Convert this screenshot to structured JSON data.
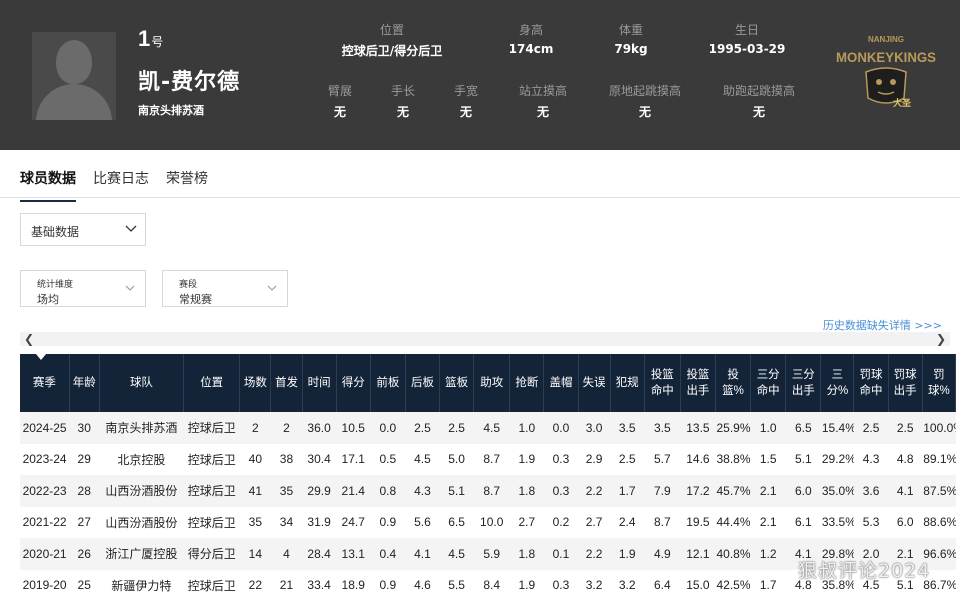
{
  "player": {
    "number": "1",
    "number_suffix": "号",
    "name": "凯-费尔德",
    "team": "南京头排苏酒"
  },
  "info_top": [
    {
      "label": "位置",
      "value": "控球后卫/得分后卫"
    },
    {
      "label": "身高",
      "value": "174cm"
    },
    {
      "label": "体重",
      "value": "79kg"
    },
    {
      "label": "生日",
      "value": "1995-03-29"
    }
  ],
  "info_bottom": [
    {
      "label": "臂展",
      "value": "无"
    },
    {
      "label": "手长",
      "value": "无"
    },
    {
      "label": "手宽",
      "value": "无"
    },
    {
      "label": "站立摸高",
      "value": "无"
    },
    {
      "label": "原地起跳摸高",
      "value": "无"
    },
    {
      "label": "助跑起跳摸高",
      "value": "无"
    }
  ],
  "logo": {
    "top_text": "NANJING",
    "main_text": "MONKEYKINGS",
    "badge": "大圣",
    "color": "#b89a5a"
  },
  "tabs": [
    "球员数据",
    "比赛日志",
    "荣誉榜"
  ],
  "filters": {
    "data_type": "基础数据",
    "dimension_label": "统计维度",
    "dimension_value": "场均",
    "phase_label": "赛段",
    "phase_value": "常规赛"
  },
  "history_link": "历史数据缺失详情 >>>",
  "table": {
    "headers": [
      "赛季",
      "年龄",
      "球队",
      "位置",
      "场数",
      "首发",
      "时间",
      "得分",
      "前板",
      "后板",
      "篮板",
      "助攻",
      "抢断",
      "盖帽",
      "失误",
      "犯规",
      "投篮命中",
      "投篮出手",
      "投篮%",
      "三分命中",
      "三分出手",
      "三分%",
      "罚球命中",
      "罚球出手",
      "罚球%"
    ],
    "rows": [
      [
        "2024-25",
        "30",
        "南京头排苏酒",
        "控球后卫",
        "2",
        "2",
        "36.0",
        "10.5",
        "0.0",
        "2.5",
        "2.5",
        "4.5",
        "1.0",
        "0.0",
        "3.0",
        "3.5",
        "3.5",
        "13.5",
        "25.9%",
        "1.0",
        "6.5",
        "15.4%",
        "2.5",
        "2.5",
        "100.0%"
      ],
      [
        "2023-24",
        "29",
        "北京控股",
        "控球后卫",
        "40",
        "38",
        "30.4",
        "17.1",
        "0.5",
        "4.5",
        "5.0",
        "8.7",
        "1.9",
        "0.3",
        "2.9",
        "2.5",
        "5.7",
        "14.6",
        "38.8%",
        "1.5",
        "5.1",
        "29.2%",
        "4.3",
        "4.8",
        "89.1%"
      ],
      [
        "2022-23",
        "28",
        "山西汾酒股份",
        "控球后卫",
        "41",
        "35",
        "29.9",
        "21.4",
        "0.8",
        "4.3",
        "5.1",
        "8.7",
        "1.8",
        "0.3",
        "2.2",
        "1.7",
        "7.9",
        "17.2",
        "45.7%",
        "2.1",
        "6.0",
        "35.0%",
        "3.6",
        "4.1",
        "87.5%"
      ],
      [
        "2021-22",
        "27",
        "山西汾酒股份",
        "控球后卫",
        "35",
        "34",
        "31.9",
        "24.7",
        "0.9",
        "5.6",
        "6.5",
        "10.0",
        "2.7",
        "0.2",
        "2.7",
        "2.4",
        "8.7",
        "19.5",
        "44.4%",
        "2.1",
        "6.1",
        "33.5%",
        "5.3",
        "6.0",
        "88.6%"
      ],
      [
        "2020-21",
        "26",
        "浙江广厦控股",
        "得分后卫",
        "14",
        "4",
        "28.4",
        "13.1",
        "0.4",
        "4.1",
        "4.5",
        "5.9",
        "1.8",
        "0.1",
        "2.2",
        "1.9",
        "4.9",
        "12.1",
        "40.8%",
        "1.2",
        "4.1",
        "29.8%",
        "2.0",
        "2.1",
        "96.6%"
      ],
      [
        "2019-20",
        "25",
        "新疆伊力特",
        "控球后卫",
        "22",
        "21",
        "33.4",
        "18.9",
        "0.9",
        "4.6",
        "5.5",
        "8.4",
        "1.9",
        "0.3",
        "3.2",
        "3.2",
        "6.4",
        "15.0",
        "42.5%",
        "1.7",
        "4.8",
        "35.8%",
        "4.5",
        "5.1",
        "86.7%"
      ]
    ]
  },
  "watermark": "狠叔评论2024"
}
